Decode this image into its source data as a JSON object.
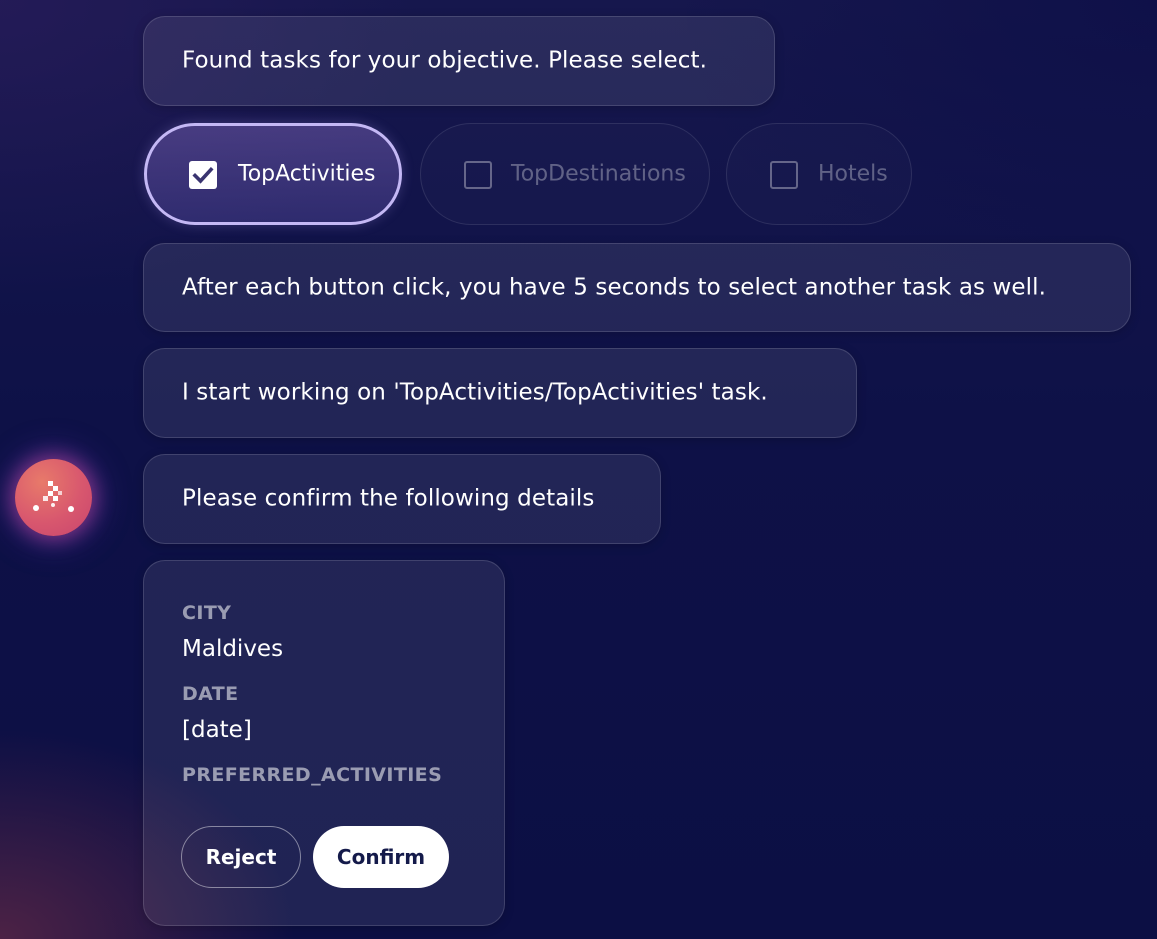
{
  "messages": {
    "found_tasks": "Found tasks for your objective. Please select.",
    "button_hint": "After each button click, you have 5 seconds to select another task as well.",
    "start_working": "I start working on 'TopActivities/TopActivities' task.",
    "confirm_prompt": "Please confirm the following details"
  },
  "tasks": [
    {
      "label": "TopActivities",
      "checked": true
    },
    {
      "label": "TopDestinations",
      "checked": false
    },
    {
      "label": "Hotels",
      "checked": false
    }
  ],
  "details": {
    "city_label": "CITY",
    "city_value": "Maldives",
    "date_label": "DATE",
    "date_value": "[date]",
    "preferred_label": "PREFERRED_ACTIVITIES",
    "preferred_value": ""
  },
  "actions": {
    "reject_label": "Reject",
    "confirm_label": "Confirm"
  },
  "colors": {
    "background": "#0e1147",
    "selected_chip_border": "#c4b8f5",
    "confirm_text": "#141a4a",
    "avatar": "#d8576e"
  },
  "icons": {
    "avatar": "assistant-logo-icon",
    "checked": "checkbox-checked-icon",
    "unchecked": "checkbox-empty-icon"
  }
}
